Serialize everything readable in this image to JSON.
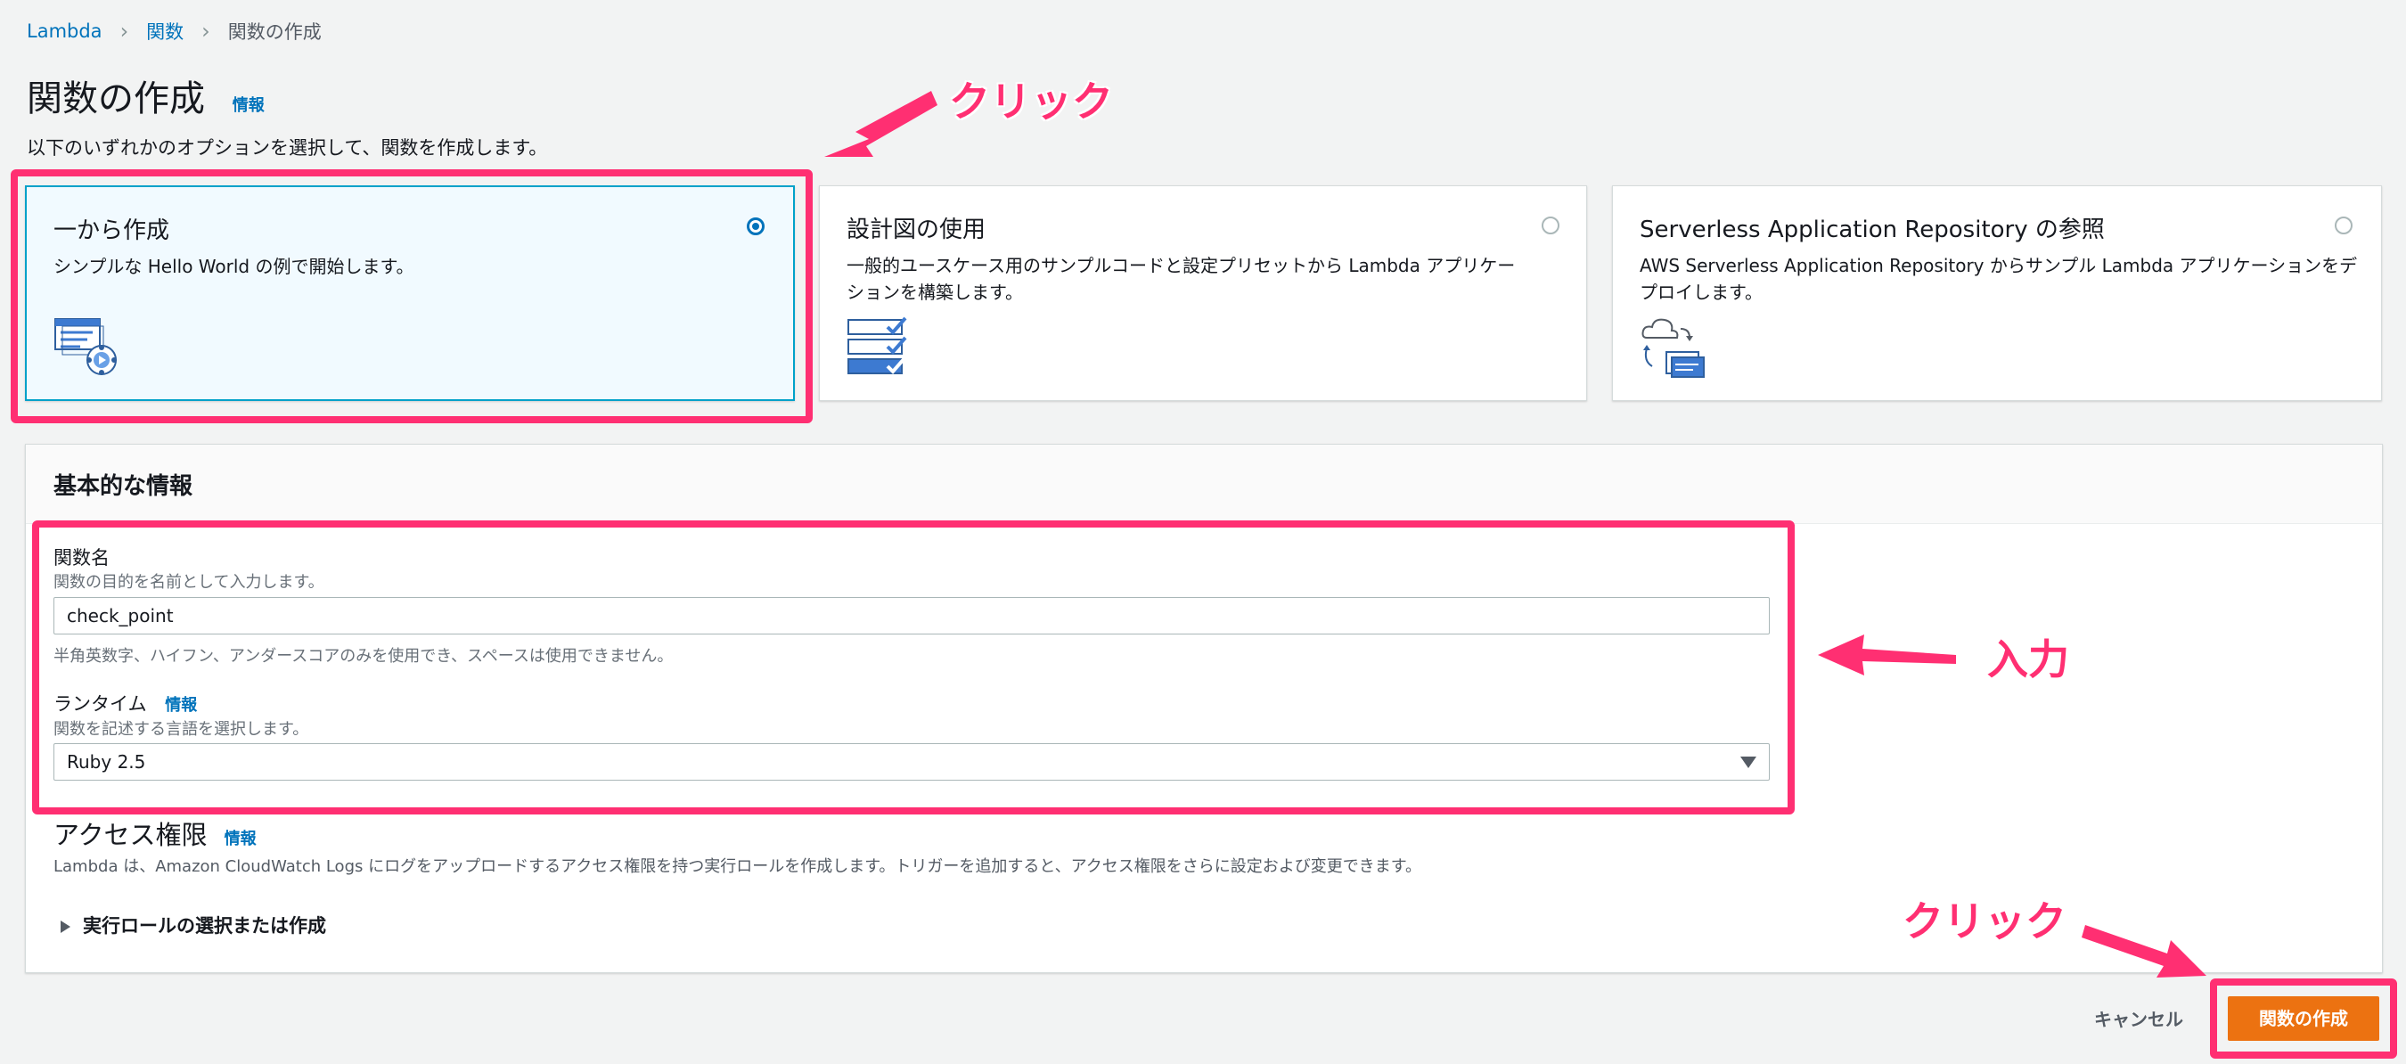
{
  "breadcrumb": {
    "home": "Lambda",
    "functions": "関数",
    "current": "関数の作成"
  },
  "page": {
    "title": "関数の作成",
    "info": "情報",
    "subtitle": "以下のいずれかのオプションを選択して、関数を作成します。"
  },
  "options": [
    {
      "title": "一から作成",
      "desc_line1": "シンプルな Hello World の例で開始します。",
      "desc_line2": "",
      "selected": true,
      "icon": "author-from-scratch-icon"
    },
    {
      "title": "設計図の使用",
      "desc_line1": "一般的ユースケース用のサンプルコードと設定プリセットから Lambda アプリケー",
      "desc_line2": "ションを構築します。",
      "selected": false,
      "icon": "blueprint-icon"
    },
    {
      "title": "Serverless Application Repository の参照",
      "desc_line1": "AWS Serverless Application Repository からサンプル Lambda アプリケーションをデ",
      "desc_line2": "プロイします。",
      "selected": false,
      "icon": "serverless-repo-icon"
    }
  ],
  "basic": {
    "heading": "基本的な情報",
    "name_label": "関数名",
    "name_desc": "関数の目的を名前として入力します。",
    "name_value": "check_point",
    "name_hint": "半角英数字、ハイフン、アンダースコアのみを使用でき、スペースは使用できません。",
    "runtime_label": "ランタイム",
    "runtime_info": "情報",
    "runtime_desc": "関数を記述する言語を選択します。",
    "runtime_value": "Ruby 2.5"
  },
  "access": {
    "title": "アクセス権限",
    "info": "情報",
    "desc": "Lambda は、Amazon CloudWatch Logs にログをアップロードするアクセス権限を持つ実行ロールを作成します。トリガーを追加すると、アクセス権限をさらに設定および変更できます。",
    "expander": "実行ロールの選択または作成"
  },
  "actions": {
    "cancel": "キャンセル",
    "create": "関数の作成"
  },
  "annotations": {
    "click_top": "クリック",
    "input": "入力",
    "click_bottom": "クリック"
  },
  "colors": {
    "accent": "#ff2f72",
    "primary_button": "#ec7211",
    "link": "#0073bb",
    "selected_card": "#00a1c9"
  }
}
